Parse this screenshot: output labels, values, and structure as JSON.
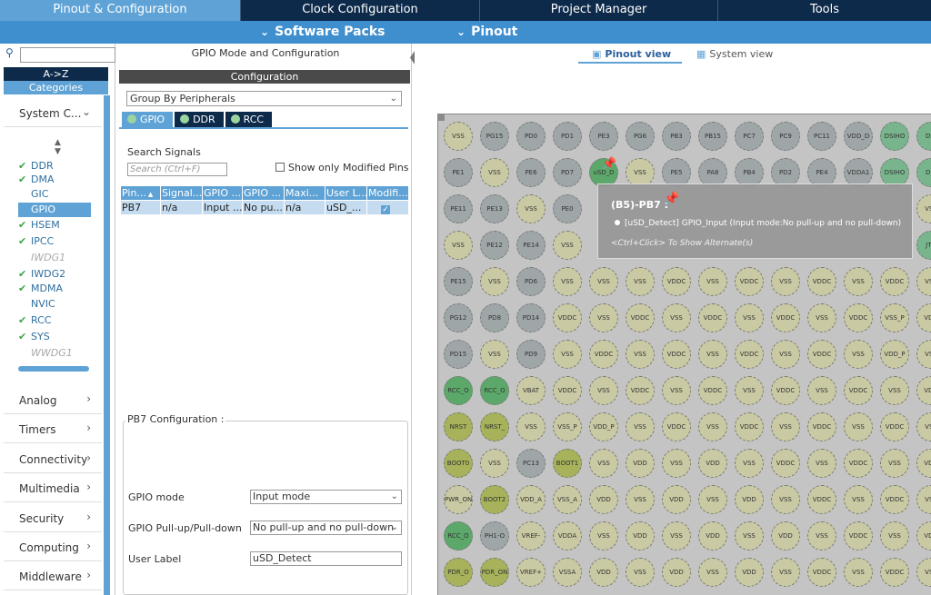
{
  "top_tabs": [
    {
      "label": "Pinout & Configuration",
      "active": true
    },
    {
      "label": "Clock Configuration",
      "active": false
    },
    {
      "label": "Project Manager",
      "active": false
    },
    {
      "label": "Tools",
      "active": false
    }
  ],
  "sub_menu": [
    {
      "label": "Software Packs"
    },
    {
      "label": "Pinout"
    }
  ],
  "left": {
    "search_placeholder": "",
    "az_label": "A->Z",
    "categories_label": "Categories",
    "system_core_label": "System C...",
    "system_items": [
      {
        "label": "DDR",
        "checked": true,
        "state": "ok"
      },
      {
        "label": "DMA",
        "checked": true,
        "state": "ok"
      },
      {
        "label": "GIC",
        "checked": false,
        "state": "normal"
      },
      {
        "label": "GPIO",
        "checked": false,
        "state": "selected"
      },
      {
        "label": "HSEM",
        "checked": true,
        "state": "ok"
      },
      {
        "label": "IPCC",
        "checked": true,
        "state": "ok"
      },
      {
        "label": "IWDG1",
        "checked": false,
        "state": "disabled"
      },
      {
        "label": "IWDG2",
        "checked": true,
        "state": "ok"
      },
      {
        "label": "MDMA",
        "checked": true,
        "state": "ok"
      },
      {
        "label": "NVIC",
        "checked": false,
        "state": "normal"
      },
      {
        "label": "RCC",
        "checked": true,
        "state": "ok"
      },
      {
        "label": "SYS",
        "checked": true,
        "state": "ok"
      },
      {
        "label": "WWDG1",
        "checked": false,
        "state": "disabled"
      }
    ],
    "sections": [
      "Analog",
      "Timers",
      "Connectivity",
      "Multimedia",
      "Security",
      "Computing",
      "Middleware"
    ]
  },
  "middle": {
    "title": "GPIO Mode and Configuration",
    "config_bar": "Configuration",
    "group_by": "Group By Peripherals",
    "peripheral_tabs": [
      {
        "label": "GPIO",
        "active": true
      },
      {
        "label": "DDR",
        "active": false
      },
      {
        "label": "RCC",
        "active": false
      }
    ],
    "search_signals_label": "Search Signals",
    "search_placeholder": "Search (Ctrl+F)",
    "show_modified_label": "Show only Modified Pins",
    "table": {
      "headers": [
        "Pin...",
        "Signal...",
        "GPIO ...",
        "GPIO ...",
        "Maxi...",
        "User L...",
        "Modifi..."
      ],
      "rows": [
        [
          "PB7",
          "n/a",
          "Input ...",
          "No pu...",
          "n/a",
          "uSD_...",
          ""
        ]
      ]
    },
    "pb7_config_label": "PB7 Configuration :",
    "fields": [
      {
        "label": "GPIO mode",
        "value": "Input mode"
      },
      {
        "label": "GPIO Pull-up/Pull-down",
        "value": "No pull-up and no pull-down"
      },
      {
        "label": "User Label",
        "value": "uSD_Detect"
      }
    ]
  },
  "right": {
    "view_tabs": [
      {
        "label": "Pinout view",
        "active": true
      },
      {
        "label": "System view",
        "active": false
      }
    ],
    "tooltip": {
      "title": "(B5)-PB7 :",
      "desc": "[uSD_Detect] GPIO_Input (Input mode:No pull-up and no pull-down)",
      "hint": "<Ctrl+Click> To Show Alternate(s)"
    },
    "pins": [
      [
        "VSS",
        "PG15",
        "PD0",
        "PD1",
        "PE3",
        "PG6",
        "PB3",
        "PB15",
        "PC7",
        "PC9",
        "PC11",
        "VDD_D",
        "DSIHO",
        "DSI"
      ],
      [
        "PE1",
        "VSS",
        "PE6",
        "PD7",
        "uSD_D",
        "VSS",
        "PE5",
        "PA8",
        "PB4",
        "PD2",
        "PE4",
        "VDDA1",
        "DSIHO",
        "DSI"
      ],
      [
        "PE11",
        "PE13",
        "VSS",
        "PE0",
        "",
        "",
        "",
        "",
        "",
        "",
        "",
        "",
        "",
        "VSS"
      ],
      [
        "VSS",
        "PE12",
        "PE14",
        "VSS",
        "",
        "",
        "",
        "",
        "",
        "",
        "",
        "",
        "",
        "JTD"
      ],
      [
        "PE15",
        "VSS",
        "PD6",
        "VSS",
        "VSS",
        "VSS",
        "VDDC",
        "VSS",
        "VDDC",
        "VSS",
        "VDDC",
        "VSS",
        "VDDC",
        "VSS"
      ],
      [
        "PG12",
        "PD8",
        "PD14",
        "VDDC",
        "VSS",
        "VDDC",
        "VSS",
        "VDDC",
        "VSS",
        "VDDC",
        "VSS",
        "VDDC",
        "VSS_P",
        "VDD"
      ],
      [
        "PD15",
        "VSS",
        "PD9",
        "VSS",
        "VDDC",
        "VSS",
        "VDDC",
        "VSS",
        "VDDC",
        "VSS",
        "VDDC",
        "VSS",
        "VDD_P",
        "VSS"
      ],
      [
        "RCC_O",
        "RCC_O",
        "VBAT",
        "VDDC",
        "VSS",
        "VDDC",
        "VSS",
        "VDDC",
        "VSS",
        "VDDC",
        "VSS",
        "VDDC",
        "VSS",
        "VDD"
      ],
      [
        "NRST",
        "NRST_",
        "VSS",
        "VSS_P",
        "VDD_P",
        "VSS",
        "VDDC",
        "VSS",
        "VDDC",
        "VSS",
        "VDDC",
        "VSS",
        "VDDC",
        "VSS"
      ],
      [
        "BOOT0",
        "VSS",
        "PC13",
        "BOOT1",
        "VSS",
        "VDD",
        "VSS",
        "VDD",
        "VSS",
        "VDDC",
        "VSS",
        "VDDC",
        "VSS",
        "VDD"
      ],
      [
        "PWR_ON",
        "BOOT2",
        "VDD_A",
        "VSS_A",
        "VDD",
        "VSS",
        "VDD",
        "VSS",
        "VDD",
        "VSS",
        "VDDC",
        "VSS",
        "VDDC",
        "VSS"
      ],
      [
        "RCC_O",
        "PH1-O",
        "VREF-",
        "VDDA",
        "VSS",
        "VDD",
        "VSS",
        "VDD",
        "VSS",
        "VDD",
        "VSS",
        "VDDC",
        "VSS",
        "VDD"
      ],
      [
        "PDR_O",
        "PDR_ON",
        "VREF+",
        "VSSA",
        "VDD",
        "VSS",
        "VDD",
        "VSS",
        "VDD",
        "VSS",
        "VDDC",
        "VSS",
        "VDDC",
        "VSS"
      ]
    ],
    "pin_colors": [
      [
        "cream",
        "gray",
        "gray",
        "gray",
        "gray",
        "gray",
        "gray",
        "gray",
        "gray",
        "gray",
        "gray",
        "gray",
        "teal",
        "teal"
      ],
      [
        "gray",
        "cream",
        "gray",
        "gray",
        "green",
        "cream",
        "gray",
        "gray",
        "gray",
        "gray",
        "gray",
        "gray",
        "teal",
        "teal"
      ],
      [
        "gray",
        "gray",
        "cream",
        "gray",
        "",
        "",
        "",
        "",
        "",
        "",
        "",
        "",
        "",
        "cream"
      ],
      [
        "cream",
        "gray",
        "gray",
        "cream",
        "",
        "",
        "",
        "",
        "",
        "",
        "",
        "",
        "",
        "teal"
      ],
      [
        "gray",
        "cream",
        "gray",
        "cream",
        "cream",
        "cream",
        "cream",
        "cream",
        "cream",
        "cream",
        "cream",
        "cream",
        "cream",
        "cream"
      ],
      [
        "gray",
        "gray",
        "gray",
        "cream",
        "cream",
        "cream",
        "cream",
        "cream",
        "cream",
        "cream",
        "cream",
        "cream",
        "cream",
        "cream"
      ],
      [
        "gray",
        "cream",
        "gray",
        "cream",
        "cream",
        "cream",
        "cream",
        "cream",
        "cream",
        "cream",
        "cream",
        "cream",
        "cream",
        "cream"
      ],
      [
        "green",
        "green",
        "cream",
        "cream",
        "cream",
        "cream",
        "cream",
        "cream",
        "cream",
        "cream",
        "cream",
        "cream",
        "cream",
        "cream"
      ],
      [
        "ygreen",
        "ygreen",
        "cream",
        "cream",
        "cream",
        "cream",
        "cream",
        "cream",
        "cream",
        "cream",
        "cream",
        "cream",
        "cream",
        "cream"
      ],
      [
        "ygreen",
        "cream",
        "gray",
        "ygreen",
        "cream",
        "cream",
        "cream",
        "cream",
        "cream",
        "cream",
        "cream",
        "cream",
        "cream",
        "cream"
      ],
      [
        "cream",
        "ygreen",
        "cream",
        "cream",
        "cream",
        "cream",
        "cream",
        "cream",
        "cream",
        "cream",
        "cream",
        "cream",
        "cream",
        "cream"
      ],
      [
        "green",
        "gray",
        "cream",
        "cream",
        "cream",
        "cream",
        "cream",
        "cream",
        "cream",
        "cream",
        "cream",
        "cream",
        "cream",
        "cream"
      ],
      [
        "ygreen",
        "ygreen",
        "cream",
        "cream",
        "cream",
        "cream",
        "cream",
        "cream",
        "cream",
        "cream",
        "cream",
        "cream",
        "cream",
        "cream"
      ]
    ]
  }
}
